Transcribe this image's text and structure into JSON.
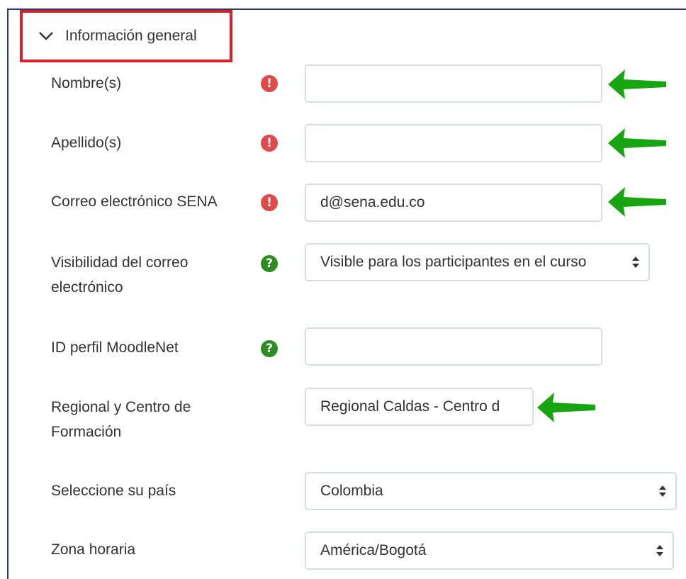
{
  "section": {
    "title": "Información general",
    "icon": "chevron-down-icon"
  },
  "fields": {
    "nombre": {
      "label": "Nombre(s)",
      "value": "",
      "icon": "required-icon"
    },
    "apellido": {
      "label": "Apellido(s)",
      "value": "",
      "icon": "required-icon"
    },
    "correo": {
      "label": "Correo electrónico SENA",
      "value": "d@sena.edu.co",
      "icon": "required-icon"
    },
    "visibilidad": {
      "label_line1": "Visibilidad del correo",
      "label_line2": "electrónico",
      "value": "Visible para los participantes en el curso",
      "icon": "help-icon"
    },
    "moodlenet": {
      "label": "ID perfil MoodleNet",
      "value": "",
      "icon": "help-icon"
    },
    "regional": {
      "label_line1": "Regional y Centro de",
      "label_line2": "Formación",
      "value": "Regional Caldas - Centro d"
    },
    "pais": {
      "label": "Seleccione su país",
      "value": "Colombia"
    },
    "zona": {
      "label": "Zona horaria",
      "value": "América/Bogotá"
    }
  },
  "icons": {
    "required_glyph": "!",
    "help_glyph": "?"
  },
  "colors": {
    "required": "#e04b4a",
    "help": "#2a8f20",
    "highlight_box": "#d5212b",
    "arrow": "#17a511"
  }
}
